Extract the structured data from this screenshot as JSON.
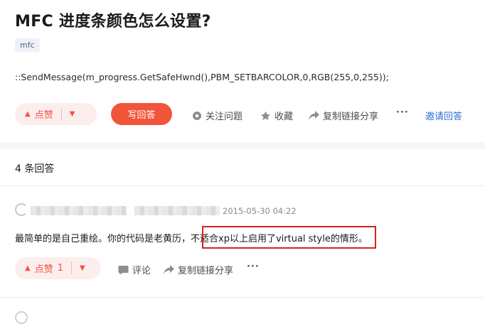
{
  "question": {
    "title": "MFC 进度条颜色怎么设置?",
    "tag": "mfc",
    "body": "::SendMessage(m_progress.GetSafeHwnd(),PBM_SETBARCOLOR,0,RGB(255,0,255));"
  },
  "question_actions": {
    "upvote_label": "点赞",
    "write_answer": "写回答",
    "follow": "关注问题",
    "favorite": "收藏",
    "share": "复制链接分享",
    "more": "···",
    "invite": "邀请回答"
  },
  "answers_header": {
    "count_label": "4 条回答"
  },
  "answer": {
    "date": "2015-05-30 04:22",
    "text_before": "最简单的是自己重绘。你的代码是老黄历，",
    "text_highlight": "不适合xp以上启用了virtual style的情形",
    "text_after": "。",
    "upvote_label": "点赞",
    "upvote_count": "1",
    "comment": "评论",
    "share": "复制链接分享",
    "more": "···"
  },
  "colors": {
    "accent": "#f0553a",
    "link": "#2e6bd6",
    "highlight_border": "#d62020"
  }
}
